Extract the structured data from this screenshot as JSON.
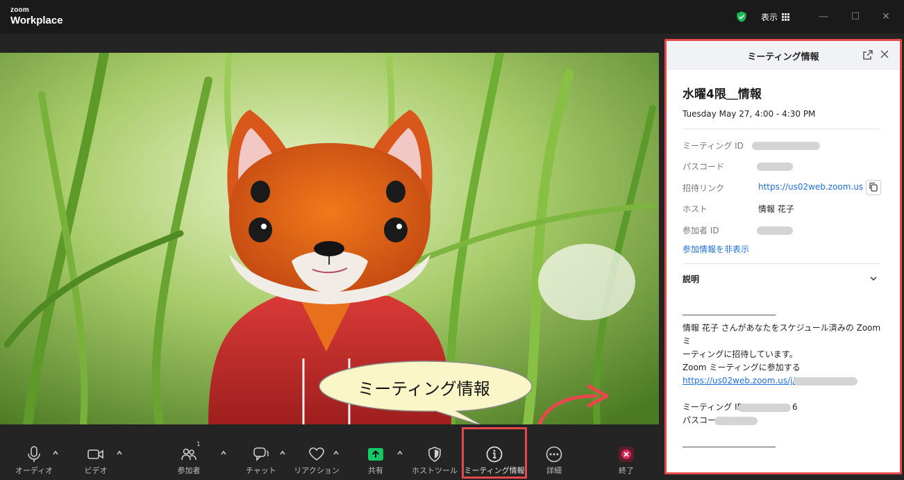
{
  "app": {
    "logo_small": "zoom",
    "logo_large": "Workplace",
    "view_label": "表示"
  },
  "video": {
    "fox_icon": "fox-avatar",
    "background": "grass-bokeh"
  },
  "bubble": {
    "text": "ミーティング情報"
  },
  "toolbar": {
    "audio": "オーディオ",
    "video": "ビデオ",
    "participants": "参加者",
    "participants_count": "1",
    "chat": "チャット",
    "reactions": "リアクション",
    "share": "共有",
    "host_tools": "ホストツール",
    "meeting_info": "ミーティング情報",
    "more": "詳細",
    "end": "終了"
  },
  "panel": {
    "header": "ミーティング情報",
    "title": "水曜4限＿情報",
    "date": "Tuesday May 27, 4:00 - 4:30 PM",
    "meeting_id_label": "ミーティング ID",
    "passcode_label": "パスコード",
    "invite_link_label": "招待リンク",
    "invite_link": "https://us02web.zoom.us...",
    "host_label": "ホスト",
    "host_name": "情報 花子",
    "participant_id_label": "参加者 ID",
    "hide_info": "参加情報を非表示",
    "description_label": "説明",
    "desc_line1": "情報 花子 さんがあなたをスケジュール済みの Zoom ミ",
    "desc_line2": "ーティングに招待しています。",
    "desc_line3": "Zoom ミーティングに参加する",
    "desc_link": "https://us02web.zoom.us/j/",
    "desc_mid_label": "ミーティング ID:",
    "desc_mid_suffix": "6",
    "desc_pass_label": "パスコード:"
  },
  "colors": {
    "highlight": "#e8474c",
    "share_green": "#17c964",
    "link_blue": "#1e6fd9"
  }
}
